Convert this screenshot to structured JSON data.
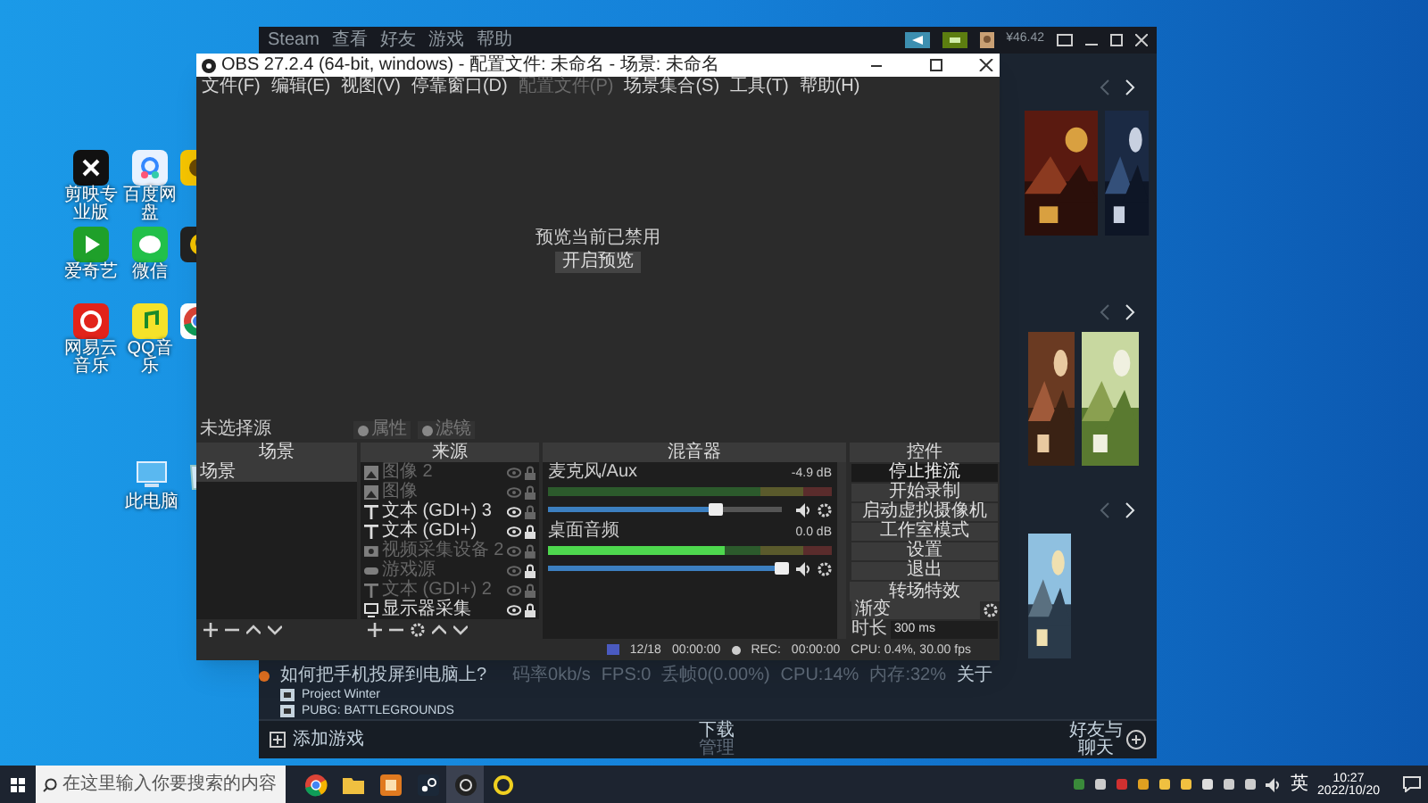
{
  "desktop": {
    "icon_rows": [
      [
        {
          "kind": "capcut",
          "label": "剪映专业版"
        },
        {
          "kind": "baidu",
          "label": "百度网盘"
        },
        {
          "kind": "yy"
        }
      ],
      [
        {
          "kind": "iqiyi",
          "label": "爱奇艺"
        },
        {
          "kind": "wechat",
          "label": "微信"
        },
        {
          "kind": "moon"
        }
      ],
      [
        {
          "kind": "netease",
          "label": "网易云音乐"
        },
        {
          "kind": "qqmusic",
          "label": "QQ音乐"
        },
        {
          "kind": "chrome"
        }
      ],
      [
        {
          "kind": "computer",
          "label": "此电脑"
        },
        {
          "kind": "recycle"
        }
      ]
    ]
  },
  "steam": {
    "menu": [
      "Steam",
      "查看",
      "好友",
      "游戏",
      "帮助"
    ],
    "balance": "¥46.42",
    "notice": "如何把手机投屏到电脑上?",
    "stats": [
      "码率0kb/s",
      "FPS:0",
      "丢帧0(0.00%)",
      "CPU:14%",
      "内存:32%",
      "关于"
    ],
    "games": [
      "Project Winter",
      "PUBG: BATTLEGROUNDS"
    ],
    "footer": {
      "add_game": "添加游戏",
      "downloads": "下载",
      "downloads_sub": "管理",
      "friends": "好友与聊天"
    }
  },
  "obs": {
    "title": "OBS 27.2.4 (64-bit, windows) - 配置文件: 未命名 - 场景: 未命名",
    "menu": [
      {
        "label": "文件(F)",
        "disabled": false
      },
      {
        "label": "编辑(E)",
        "disabled": false
      },
      {
        "label": "视图(V)",
        "disabled": false
      },
      {
        "label": "停靠窗口(D)",
        "disabled": false
      },
      {
        "label": "配置文件(P)",
        "disabled": true
      },
      {
        "label": "场景集合(S)",
        "disabled": false
      },
      {
        "label": "工具(T)",
        "disabled": false
      },
      {
        "label": "帮助(H)",
        "disabled": false
      }
    ],
    "preview": {
      "message": "预览当前已禁用",
      "button": "开启预览"
    },
    "source_bar": {
      "label": "未选择源",
      "buttons": [
        "属性",
        "滤镜"
      ]
    },
    "scenes": {
      "title": "场景",
      "items": [
        {
          "label": "场景",
          "selected": true
        }
      ]
    },
    "sources": {
      "title": "来源",
      "items": [
        {
          "label": "图像 2",
          "visible": false,
          "locked": false
        },
        {
          "label": "图像",
          "visible": false,
          "locked": false
        },
        {
          "kind": "text",
          "label": "文本 (GDI+) 3",
          "visible": true,
          "locked": false
        },
        {
          "kind": "text",
          "label": "文本 (GDI+)",
          "visible": true,
          "locked": true
        },
        {
          "kind": "camera",
          "label": "视频采集设备 2",
          "visible": false,
          "locked": false
        },
        {
          "kind": "game",
          "label": "游戏源",
          "visible": false,
          "locked": true
        },
        {
          "kind": "text",
          "label": "文本 (GDI+) 2",
          "visible": false,
          "locked": false
        },
        {
          "kind": "monitor",
          "label": "显示器采集",
          "visible": true,
          "locked": true
        }
      ]
    },
    "mixer": {
      "title": "混音器",
      "channels": [
        {
          "name": "麦克风/Aux",
          "reading": "-4.9 dB",
          "level": 0.72
        },
        {
          "name": "桌面音频",
          "reading": "0.0 dB",
          "level": 1,
          "meter": {
            "level": 0.62
          }
        }
      ]
    },
    "controls": {
      "title": "控件",
      "buttons": [
        {
          "label": "停止推流",
          "active": true
        },
        {
          "label": "开始录制",
          "active": false
        },
        {
          "label": "启动虚拟摄像机",
          "active": false
        },
        {
          "label": "工作室模式",
          "active": false
        },
        {
          "label": "设置",
          "active": false
        },
        {
          "label": "退出",
          "active": false
        }
      ]
    },
    "transitions": {
      "title": "转场特效",
      "value": "渐变",
      "duration_label": "时长",
      "duration": "300 ms"
    },
    "status": [
      "12/18",
      "00:00:00",
      "REC:",
      "00:00:00",
      "CPU: 0.4%, 30.00 fps"
    ]
  },
  "taskbar": {
    "search_placeholder": "在这里输入你要搜索的内容",
    "apps": [
      {
        "kind": "chrome",
        "active": false
      },
      {
        "kind": "folder",
        "active": false
      },
      {
        "kind": "orange",
        "active": false
      },
      {
        "kind": "steam",
        "active": false
      },
      {
        "kind": "obs",
        "active": true
      },
      {
        "kind": "ring",
        "active": false
      }
    ],
    "ime": "英",
    "time": "10:27",
    "date": "2022/10/20"
  }
}
